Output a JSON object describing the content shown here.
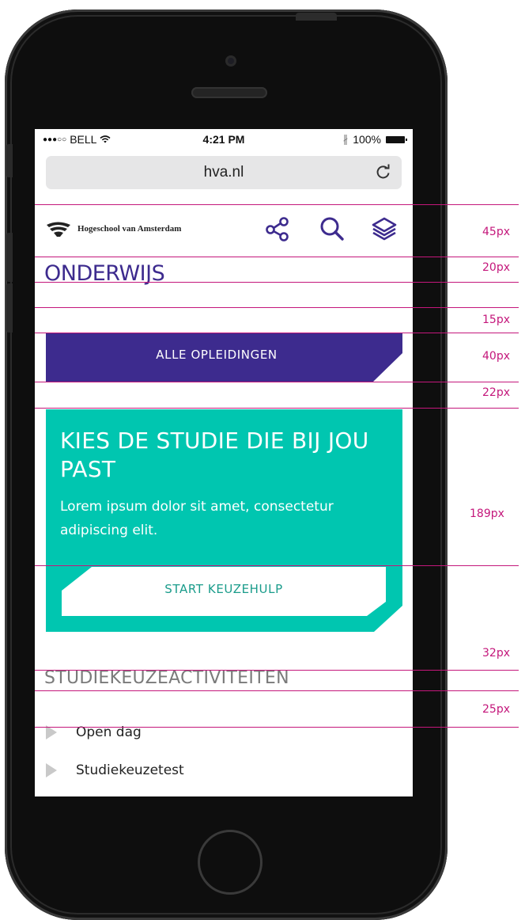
{
  "status_bar": {
    "signal_dots": "●●●○○",
    "carrier": "BELL",
    "time": "4:21 PM",
    "battery_percent": "100%"
  },
  "browser": {
    "url": "hva.nl"
  },
  "site": {
    "logo_text": "Hogeschool van Amsterdam"
  },
  "section": {
    "title": "ONDERWIJS"
  },
  "all_programs_button": {
    "label": "ALLE OPLEIDINGEN"
  },
  "promo": {
    "title": "KIES DE STUDIE DIE BIJ JOU PAST",
    "text": "Lorem ipsum dolor sit amet, consectetur adipiscing elit.",
    "button_label": "START KEUZEHULP"
  },
  "activities": {
    "title": "STUDIEKEUZEACTIVITEITEN",
    "items": [
      {
        "label": "Open dag"
      },
      {
        "label": "Studiekeuzetest"
      }
    ]
  },
  "annotations": [
    "45px",
    "20px",
    "15px",
    "40px",
    "22px",
    "189px",
    "32px",
    "25px"
  ],
  "colors": {
    "brand_purple": "#3d2b8e",
    "brand_teal": "#00c6b0",
    "guide_magenta": "#c4177b"
  }
}
